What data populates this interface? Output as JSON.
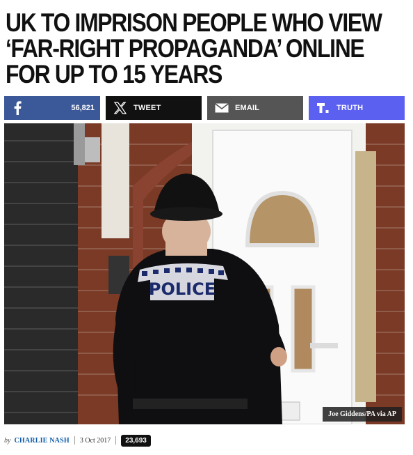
{
  "article": {
    "headline": "UK TO IMPRISON PEOPLE WHO VIEW ‘FAR-RIGHT PROPAGANDA’ ONLINE FOR UP TO 15 YEARS",
    "photo_credit": "Joe Giddens/PA via AP",
    "photo_text": "POLICE",
    "byline": {
      "by": "by",
      "author": "CHARLIE NASH",
      "date": "3 Oct 2017",
      "views": "23,693"
    }
  },
  "share": {
    "facebook": {
      "icon": "facebook-icon",
      "count": "56,821",
      "color": "#3b5998"
    },
    "twitter": {
      "icon": "x-icon",
      "label": "TWEET",
      "color": "#111111"
    },
    "email": {
      "icon": "envelope-icon",
      "label": "EMAIL",
      "color": "#555555"
    },
    "truth": {
      "icon": "truth-social-icon",
      "label": "TRUTH",
      "color": "#5b60f0"
    }
  }
}
